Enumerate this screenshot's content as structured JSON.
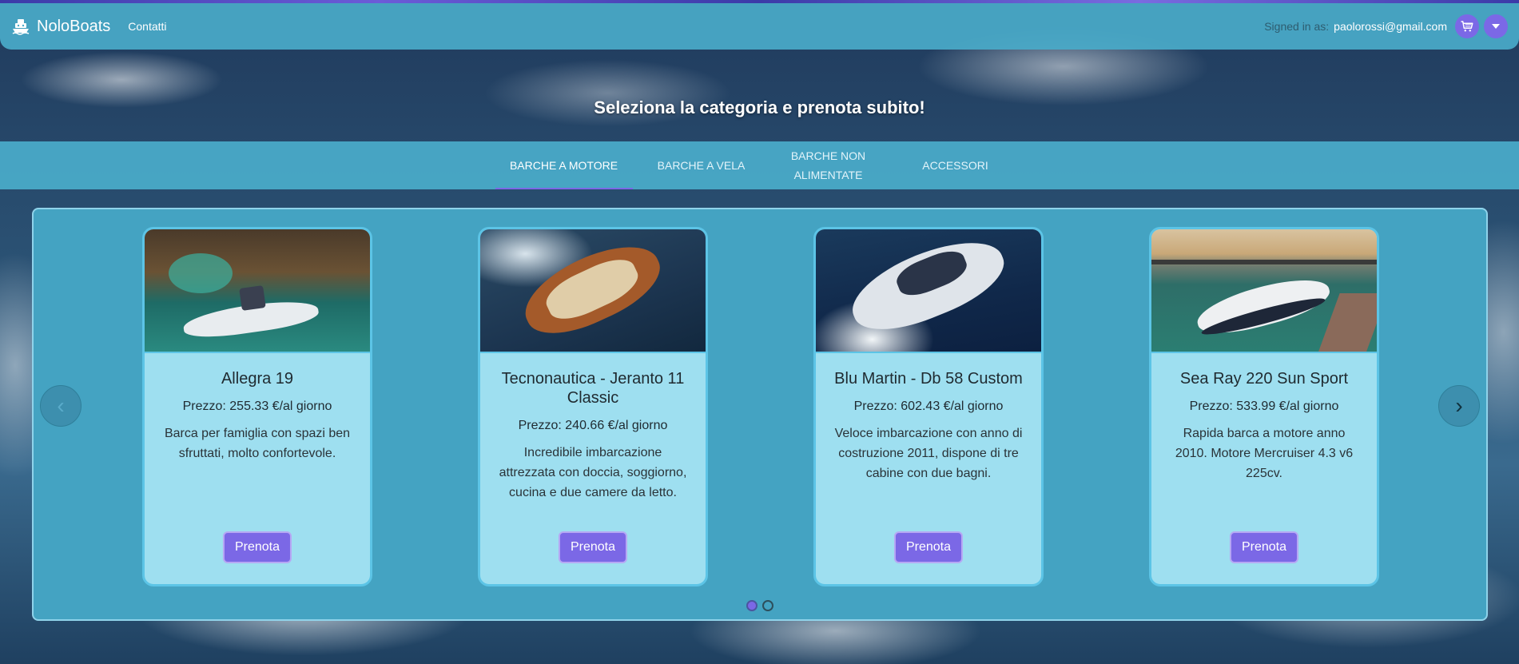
{
  "navbar": {
    "brand": "NoloBoats",
    "brand_icon": "boat-icon",
    "links": [
      "Contatti"
    ],
    "signed_in_label": "Signed in as:",
    "user_email": "paolorossi@gmail.com",
    "cart_icon": "cart-icon",
    "menu_icon": "chevron-down-icon"
  },
  "hero": {
    "title": "Seleziona la categoria e prenota subito!"
  },
  "tabs": [
    {
      "label": "BARCHE A MOTORE",
      "active": true
    },
    {
      "label": "BARCHE A VELA",
      "active": false
    },
    {
      "label": "BARCHE NON ALIMENTATE",
      "active": false
    },
    {
      "label": "ACCESSORI",
      "active": false
    }
  ],
  "cards": [
    {
      "title": "Allegra 19",
      "price": "Prezzo: 255.33 €/al giorno",
      "description": "Barca per famiglia con spazi ben sfruttati, molto confortevole.",
      "button": "Prenota"
    },
    {
      "title": "Tecnonautica - Jeranto 11 Classic",
      "price": "Prezzo: 240.66 €/al giorno",
      "description": "Incredibile imbarcazione attrezzata con doccia, soggiorno, cucina e due camere da letto.",
      "button": "Prenota"
    },
    {
      "title": "Blu Martin - Db 58 Custom",
      "price": "Prezzo: 602.43 €/al giorno",
      "description": "Veloce imbarcazione con anno di costruzione 2011, dispone di tre cabine con due bagni.",
      "button": "Prenota"
    },
    {
      "title": "Sea Ray 220 Sun Sport",
      "price": "Prezzo: 533.99 €/al giorno",
      "description": "Rapida barca a motore anno 2010. Motore Mercruiser 4.3 v6 225cv.",
      "button": "Prenota"
    }
  ],
  "carousel": {
    "prev_icon": "chevron-left-icon",
    "next_icon": "chevron-right-icon",
    "page_count": 2,
    "active_page": 1
  },
  "colors": {
    "accent": "#7b68e6",
    "navbar": "#49aac8",
    "card_bg": "#9edff0"
  }
}
